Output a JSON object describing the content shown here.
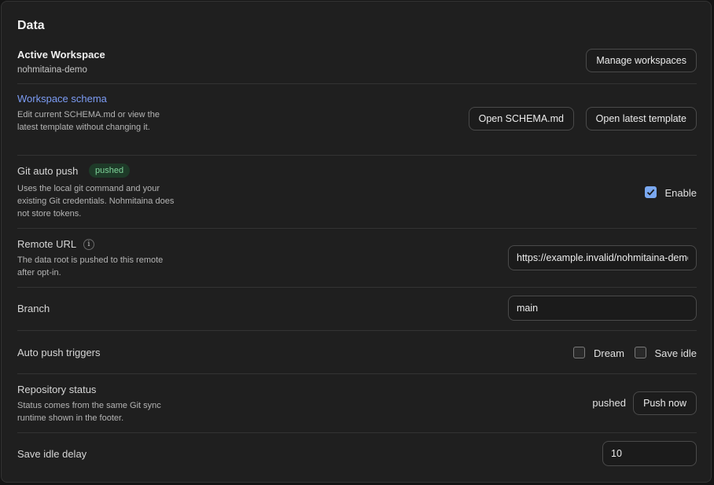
{
  "section": {
    "title": "Data"
  },
  "active_workspace": {
    "label": "Active Workspace",
    "value": "nohmitaina-demo",
    "button": "Manage workspaces"
  },
  "workspace_schema": {
    "label": "Workspace schema",
    "description": "Edit current SCHEMA.md or view the latest template without changing it.",
    "open_schema_button": "Open SCHEMA.md",
    "open_template_button": "Open latest template"
  },
  "git_auto_push": {
    "label": "Git auto push",
    "badge": "pushed",
    "description": "Uses the local git command and your existing Git credentials. Nohmitaina does not store tokens.",
    "enable_label": "Enable",
    "enabled": true
  },
  "remote_url": {
    "label": "Remote URL",
    "info_icon": "i",
    "description": "The data root is pushed to this remote after opt-in.",
    "value": "https://example.invalid/nohmitaina-demo.git"
  },
  "branch": {
    "label": "Branch",
    "value": "main"
  },
  "auto_push_triggers": {
    "label": "Auto push triggers",
    "dream_label": "Dream",
    "dream_checked": false,
    "save_idle_label": "Save idle",
    "save_idle_checked": false
  },
  "repository_status": {
    "label": "Repository status",
    "description": "Status comes from the same Git sync runtime shown in the footer.",
    "status": "pushed",
    "push_button": "Push now"
  },
  "save_idle_delay": {
    "label": "Save idle delay",
    "value": "10"
  },
  "colors": {
    "accent": "#7aa8f0",
    "link": "#7c9cf4",
    "badge_bg": "#1e3a28",
    "badge_text": "#7fd49a"
  }
}
